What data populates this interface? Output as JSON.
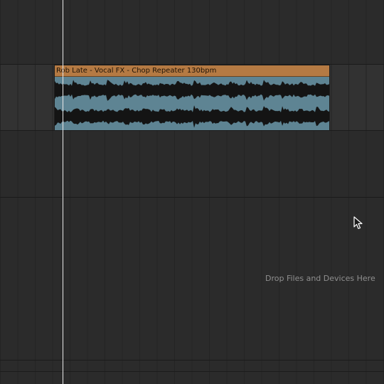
{
  "clip": {
    "name": "Rob Late - Vocal FX - Chop Repeater 130bpm",
    "header_color": "#b57a43",
    "body_color": "#5e8493",
    "waveform_color": "#141414"
  },
  "drop_area": {
    "hint": "Drop Files and Devices Here"
  },
  "cursor": {
    "icon": "arrow-cursor-icon"
  }
}
